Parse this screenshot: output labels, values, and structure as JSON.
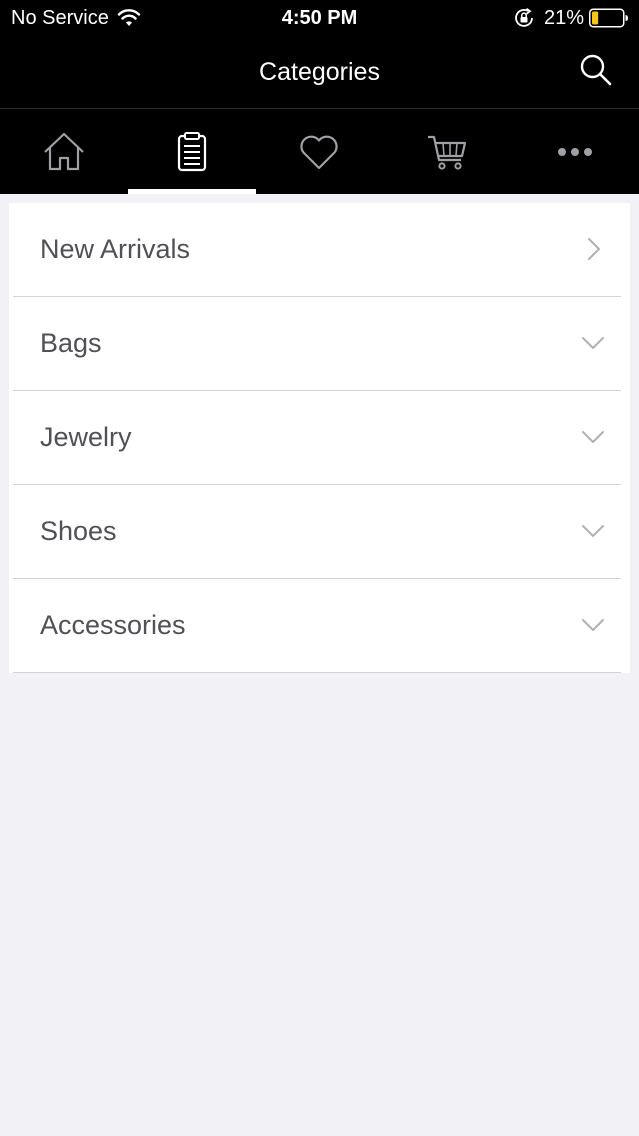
{
  "status_bar": {
    "carrier": "No Service",
    "time": "4:50 PM",
    "battery_percent": "21%",
    "battery_level": 0.21,
    "battery_color": "#f5c518"
  },
  "header": {
    "title": "Categories"
  },
  "tabs": [
    {
      "name": "home",
      "icon": "home-icon",
      "active": false
    },
    {
      "name": "categories",
      "icon": "clipboard-list-icon",
      "active": true
    },
    {
      "name": "wishlist",
      "icon": "heart-icon",
      "active": false
    },
    {
      "name": "cart",
      "icon": "cart-icon",
      "active": false
    },
    {
      "name": "more",
      "icon": "more-dots-icon",
      "active": false
    }
  ],
  "categories": [
    {
      "label": "New Arrivals",
      "indicator": "chevron-right-icon"
    },
    {
      "label": "Bags",
      "indicator": "chevron-down-icon"
    },
    {
      "label": "Jewelry",
      "indicator": "chevron-down-icon"
    },
    {
      "label": "Shoes",
      "indicator": "chevron-down-icon"
    },
    {
      "label": "Accessories",
      "indicator": "chevron-down-icon"
    }
  ],
  "colors": {
    "header_bg": "#000000",
    "page_bg": "#f2f1f5",
    "text": "#505055",
    "divider": "#d4d4d6",
    "icon_gray": "#a0a0a5"
  }
}
